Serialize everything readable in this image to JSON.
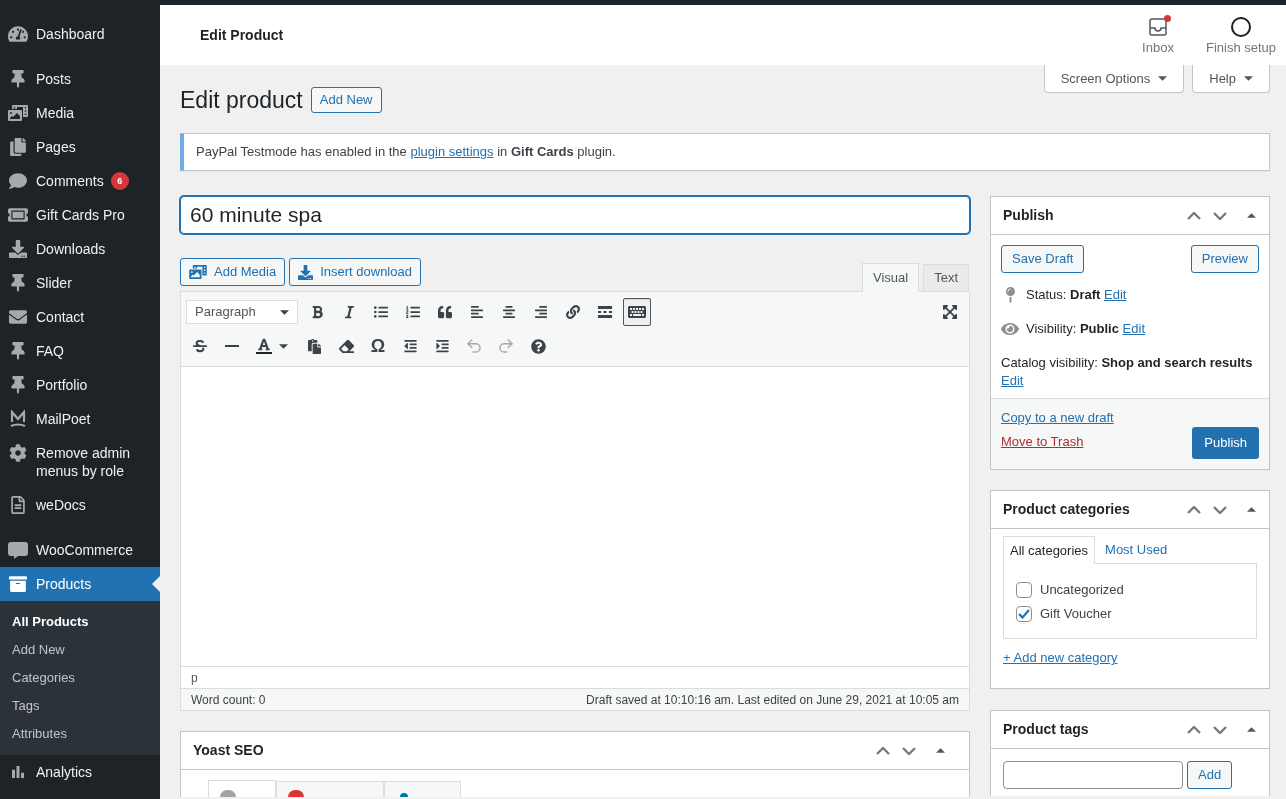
{
  "sidebar": {
    "groups": [
      {
        "items": [
          {
            "label": "Dashboard",
            "selected": false
          }
        ]
      },
      {
        "items": [
          {
            "label": "Posts",
            "selected": false
          },
          {
            "label": "Media",
            "selected": false
          },
          {
            "label": "Pages",
            "selected": false
          },
          {
            "label": "Comments",
            "selected": false,
            "badge": "6"
          },
          {
            "label": "Gift Cards Pro",
            "selected": false
          },
          {
            "label": "Downloads",
            "selected": false
          },
          {
            "label": "Slider",
            "selected": false
          },
          {
            "label": "Contact",
            "selected": false
          },
          {
            "label": "FAQ",
            "selected": false
          },
          {
            "label": "Portfolio",
            "selected": false
          },
          {
            "label": "MailPoet",
            "selected": false
          },
          {
            "label": "Remove admin menus by role",
            "selected": false
          },
          {
            "label": "weDocs",
            "selected": false
          }
        ]
      },
      {
        "items": [
          {
            "label": "WooCommerce",
            "selected": false
          },
          {
            "label": "Products",
            "selected": true,
            "children": [
              {
                "label": "All Products",
                "selected": true
              },
              {
                "label": "Add New",
                "selected": false
              },
              {
                "label": "Categories",
                "selected": false
              },
              {
                "label": "Tags",
                "selected": false
              },
              {
                "label": "Attributes",
                "selected": false
              }
            ]
          },
          {
            "label": "Analytics",
            "selected": false
          }
        ]
      }
    ]
  },
  "header": {
    "title": "Edit Product",
    "actions": [
      {
        "kind": "inbox",
        "label": "Inbox",
        "unread": true
      },
      {
        "kind": "setup",
        "label": "Finish setup"
      }
    ]
  },
  "screen_tabs": [
    "Screen Options",
    "Help"
  ],
  "page": {
    "heading": "Edit product",
    "add_new": "Add New"
  },
  "notice": {
    "text_before": "PayPal Testmode has enabled in the",
    "link": "plugin settings",
    "text_after": "in **Gift Cards** plugin."
  },
  "editor": {
    "title_value": "60 minute spa",
    "media_buttons": [
      {
        "kind": "media",
        "label": "Add Media"
      },
      {
        "kind": "download",
        "label": "Insert download"
      }
    ],
    "tabs": [
      {
        "label": "Visual",
        "selected": true
      },
      {
        "label": "Text",
        "selected": false
      }
    ],
    "toolbar": {
      "format": "Paragraph",
      "special_char": "Ω",
      "toggle_pressed": true,
      "undo_disabled": true,
      "redo_disabled": true
    },
    "path": "p",
    "word_count": "Word count: 0",
    "save_status": "Draft saved at 10:10:16 am. Last edited on June 29, 2021 at 10:05 am"
  },
  "yoast": {
    "title": "Yoast SEO",
    "tabs": [
      {
        "kind": "dot",
        "color": "#a0a5aa",
        "selected": true
      },
      {
        "kind": "dot",
        "color": "#dc3232",
        "selected": false
      },
      {
        "kind": "person",
        "color": "#0075b3",
        "selected": false
      }
    ]
  },
  "publish": {
    "title": "Publish",
    "save_draft": "Save Draft",
    "preview": "Preview",
    "rows": [
      {
        "kind": "status",
        "text": "Status: **Draft**",
        "edit": "Edit"
      },
      {
        "kind": "visibility",
        "text": "Visibility: **Public**",
        "edit": "Edit"
      },
      {
        "kind": "catalog",
        "text": "Catalog visibility: **Shop and search results**",
        "edit": "Edit"
      }
    ],
    "copy_link": "Copy to a new draft",
    "trash_link": "Move to Trash",
    "publish_button": "Publish"
  },
  "categories": {
    "title": "Product categories",
    "tabs": [
      {
        "label": "All categories",
        "selected": true
      },
      {
        "label": "Most Used",
        "selected": false
      }
    ],
    "items": [
      {
        "label": "Uncategorized",
        "checked": false
      },
      {
        "label": "Gift Voucher",
        "checked": true
      }
    ],
    "add_link": "+ Add new category"
  },
  "tags": {
    "title": "Product tags",
    "button": "Add"
  }
}
